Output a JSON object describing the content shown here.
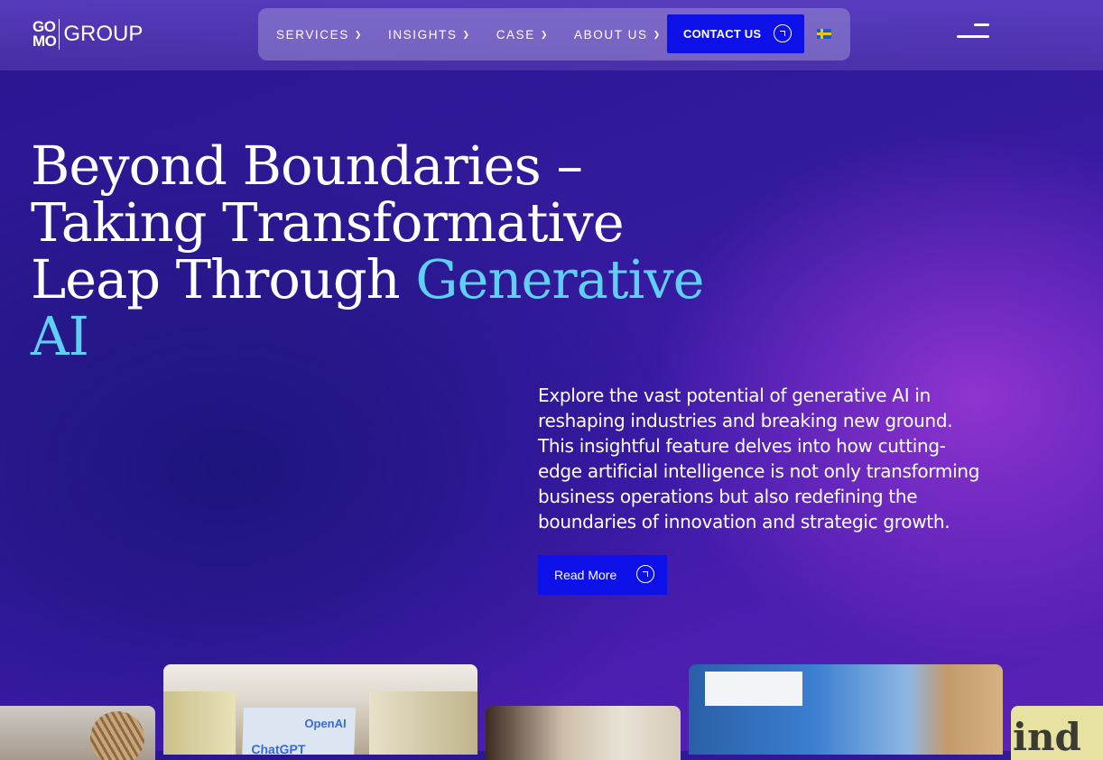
{
  "header": {
    "logo": {
      "mark_top": "GO",
      "mark_bottom": "MO",
      "wordmark": "GROUP"
    },
    "nav": [
      {
        "label": "SERVICES",
        "icon": "chevron-down-icon"
      },
      {
        "label": "INSIGHTS",
        "icon": "chevron-down-icon"
      },
      {
        "label": "CASE",
        "icon": "chevron-down-icon"
      },
      {
        "label": "ABOUT US",
        "icon": "chevron-down-icon"
      }
    ],
    "contact_label": "CONTACT US",
    "language_flag": "sweden-flag-icon",
    "menu_icon": "hamburger-menu-icon"
  },
  "hero": {
    "title_part1": "Beyond Boundaries –",
    "title_part2": "Taking Transformative",
    "title_part3": "Leap Through",
    "title_accent": "Generative AI",
    "description": "Explore the vast potential of generative AI in reshaping industries and breaking new ground. This insightful feature delves into how cutting-edge artificial intelligence is not only transforming business operations but also redefining the boundaries of innovation and strategic growth.",
    "cta_label": "Read More"
  },
  "gallery": {
    "card2_text1": "OpenAI",
    "card2_text2": "ChatGPT",
    "card5_text": "ind"
  },
  "colors": {
    "accent": "#5fd0f4",
    "button": "#0e10e8"
  }
}
